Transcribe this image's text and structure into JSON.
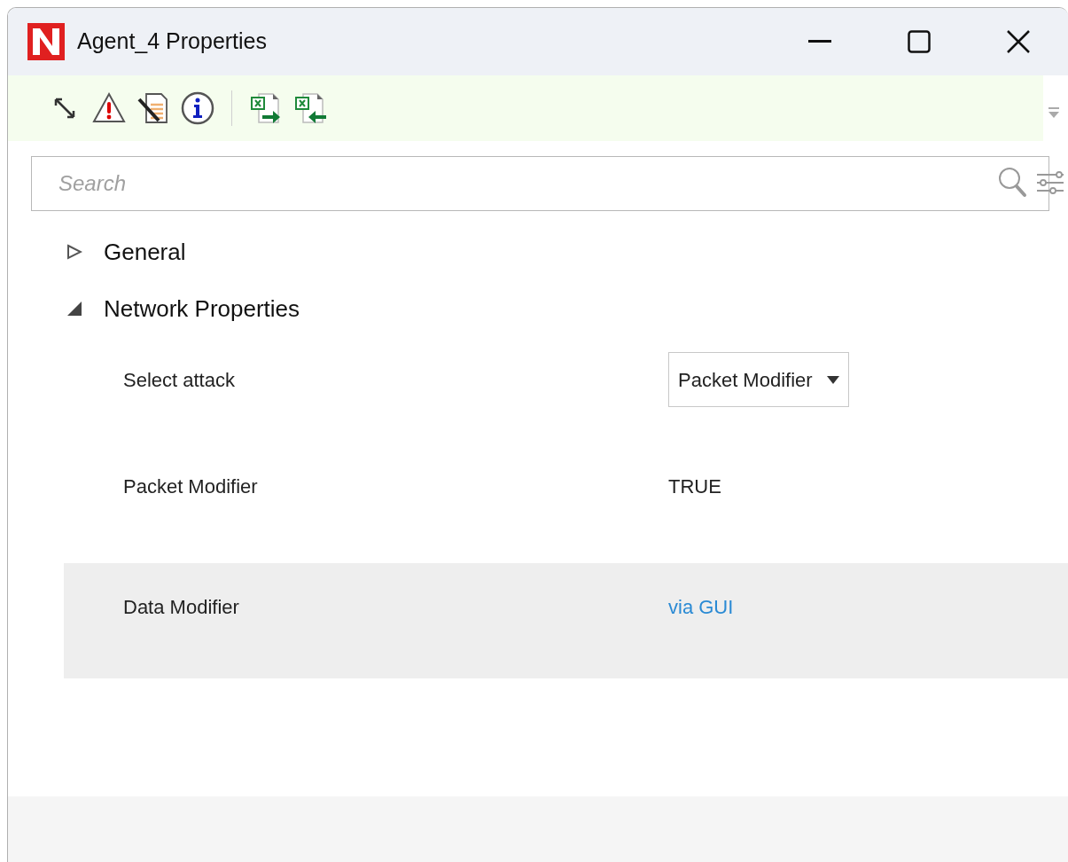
{
  "window": {
    "title": "Agent_4 Properties"
  },
  "toolbar": {
    "buttons": [
      {
        "kind": "expand"
      },
      {
        "kind": "warning"
      },
      {
        "kind": "edit"
      },
      {
        "kind": "info"
      },
      {
        "kind": "separator"
      },
      {
        "kind": "export"
      },
      {
        "kind": "import"
      }
    ]
  },
  "search": {
    "placeholder": "Search"
  },
  "groups": [
    {
      "label": "General",
      "expanded": false
    },
    {
      "label": "Network Properties",
      "expanded": true,
      "properties": [
        {
          "label": "Select attack",
          "kind": "dropdown",
          "value": "Packet Modifier",
          "selected": false
        },
        {
          "label": "Packet Modifier",
          "kind": "text",
          "value": "TRUE",
          "selected": false
        },
        {
          "label": "Data Modifier",
          "kind": "link",
          "value": "via GUI",
          "selected": true
        }
      ]
    }
  ]
}
